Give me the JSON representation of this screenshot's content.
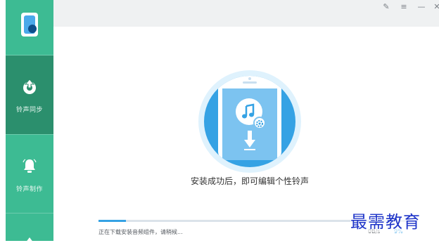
{
  "sidebar": {
    "items": [
      {
        "label": "铃声同步",
        "icon": "upload-arrow-icon",
        "active": true
      },
      {
        "label": "铃声制作",
        "icon": "bell-icon",
        "active": false
      },
      {
        "label": "",
        "icon": "more-icon",
        "active": false
      }
    ]
  },
  "window_controls": {
    "edit": "✎",
    "menu": "≡",
    "minimize": "—",
    "close": "✕"
  },
  "main": {
    "message": "安装成功后，即可编辑个性铃声",
    "status": "正在下载安装音频组件，请稍候...",
    "speed": "0B/s",
    "percent": "9%",
    "progress": 0.09
  },
  "watermark": "最需教育",
  "colors": {
    "sidebar": "#3dbb93",
    "sidebar_active": "#2b8f6d",
    "accent": "#35a2e4"
  }
}
